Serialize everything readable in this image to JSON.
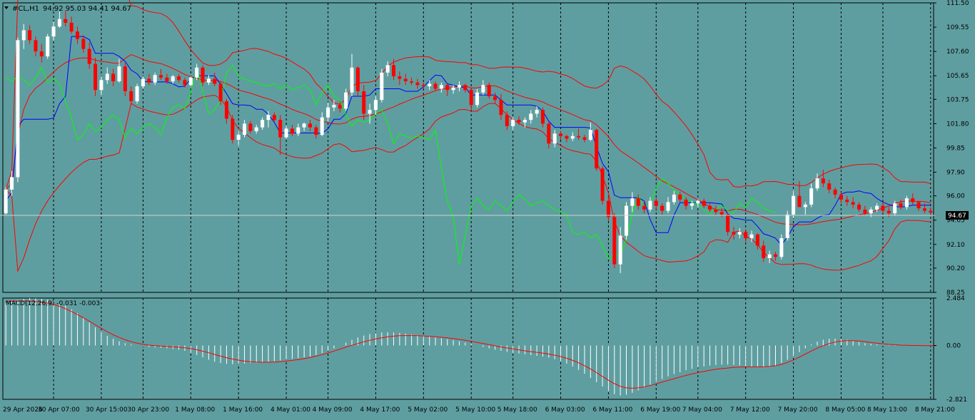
{
  "chart": {
    "symbol_label": "#CL,H1",
    "ohlc": "94.92 95.03 94.41 94.67",
    "current_price": "94.67"
  },
  "macd": {
    "label": "MACD(12,26,9) -0.031 -0.003"
  },
  "price_axis": [
    "111.50",
    "109.55",
    "107.60",
    "105.65",
    "103.75",
    "101.80",
    "99.85",
    "97.90",
    "96.00",
    "94.05",
    "92.10",
    "90.20",
    "88.25"
  ],
  "macd_axis": [
    "2.484",
    "0.00",
    "-2.821"
  ],
  "time_axis": [
    "29 Apr 2026",
    "30 Apr 07:00",
    "30 Apr 15:00",
    "30 Apr 23:00",
    "1 May 08:00",
    "1 May 16:00",
    "4 May 01:00",
    "4 May 09:00",
    "4 May 17:00",
    "5 May 02:00",
    "5 May 10:00",
    "5 May 18:00",
    "6 May 03:00",
    "6 May 11:00",
    "6 May 19:00",
    "7 May 04:00",
    "7 May 12:00",
    "7 May 20:00",
    "8 May 05:00",
    "8 May 13:00",
    "8 May 21:00"
  ],
  "colors": {
    "background": "#5F9EA0",
    "bull": "#FFFFFF",
    "bear": "#FF0000",
    "bands": "#FF0000",
    "tenkan": "#0000FF",
    "chikou": "#00FF00",
    "cloud": "#F4A460",
    "macd_signal": "#FF0000",
    "macd_hist": "#FFFFFF"
  },
  "chart_data": {
    "type": "candlestick",
    "price_range": [
      88.25,
      111.5
    ],
    "macd_range": [
      -2.821,
      2.484
    ],
    "candles": [
      [
        94.6,
        96.7,
        94.5,
        96.5
      ],
      [
        96.5,
        98.0,
        96.0,
        97.5
      ],
      [
        97.5,
        108.7,
        97.1,
        108.5
      ],
      [
        108.5,
        109.8,
        107.8,
        109.3
      ],
      [
        109.3,
        109.7,
        108.2,
        108.5
      ],
      [
        108.5,
        108.8,
        107.2,
        107.6
      ],
      [
        107.6,
        108.2,
        106.7,
        107.2
      ],
      [
        107.2,
        109.0,
        107.0,
        108.8
      ],
      [
        108.8,
        110.0,
        108.5,
        109.6
      ],
      [
        109.6,
        110.8,
        109.5,
        110.2
      ],
      [
        110.2,
        110.9,
        109.6,
        109.9
      ],
      [
        109.9,
        110.4,
        109.0,
        109.2
      ],
      [
        109.2,
        109.6,
        108.2,
        108.6
      ],
      [
        108.6,
        108.9,
        107.5,
        107.8
      ],
      [
        107.8,
        108.3,
        106.2,
        106.6
      ],
      [
        106.6,
        107.1,
        104.0,
        104.5
      ],
      [
        104.5,
        105.6,
        104.1,
        105.3
      ],
      [
        105.3,
        106.3,
        105.0,
        105.8
      ],
      [
        105.8,
        106.2,
        104.8,
        105.2
      ],
      [
        105.2,
        107.0,
        105.1,
        106.4
      ],
      [
        106.4,
        106.7,
        104.0,
        104.4
      ],
      [
        104.4,
        104.8,
        103.3,
        103.6
      ],
      [
        103.6,
        105.0,
        103.4,
        104.8
      ],
      [
        104.8,
        105.6,
        104.6,
        105.4
      ],
      [
        105.4,
        105.8,
        104.9,
        105.1
      ],
      [
        105.1,
        105.9,
        104.9,
        105.7
      ],
      [
        105.7,
        106.2,
        105.3,
        105.5
      ],
      [
        105.5,
        105.8,
        105.0,
        105.2
      ],
      [
        105.2,
        105.7,
        105.0,
        105.6
      ],
      [
        105.6,
        105.8,
        105.1,
        105.3
      ],
      [
        105.3,
        105.5,
        104.7,
        104.9
      ],
      [
        104.9,
        105.6,
        104.8,
        105.5
      ],
      [
        105.5,
        106.6,
        105.3,
        106.3
      ],
      [
        106.3,
        106.5,
        104.8,
        105.1
      ],
      [
        105.1,
        105.7,
        104.9,
        105.4
      ],
      [
        105.4,
        105.9,
        104.8,
        105.0
      ],
      [
        105.0,
        105.1,
        103.3,
        103.6
      ],
      [
        103.6,
        103.8,
        101.8,
        102.2
      ],
      [
        102.2,
        102.5,
        100.2,
        100.5
      ],
      [
        100.5,
        101.2,
        100.0,
        100.9
      ],
      [
        100.9,
        102.1,
        100.7,
        101.8
      ],
      [
        101.8,
        102.0,
        101.0,
        101.2
      ],
      [
        101.2,
        101.7,
        101.0,
        101.5
      ],
      [
        101.5,
        102.3,
        101.3,
        102.1
      ],
      [
        102.1,
        102.8,
        101.5,
        102.5
      ],
      [
        102.5,
        102.7,
        101.9,
        102.1
      ],
      [
        102.1,
        102.5,
        99.3,
        100.7
      ],
      [
        100.7,
        101.6,
        100.6,
        101.4
      ],
      [
        101.4,
        101.7,
        100.8,
        101.0
      ],
      [
        101.0,
        101.8,
        100.8,
        101.5
      ],
      [
        101.5,
        101.9,
        101.2,
        101.8
      ],
      [
        101.8,
        102.1,
        101.2,
        101.5
      ],
      [
        101.5,
        101.7,
        100.6,
        100.9
      ],
      [
        100.9,
        102.7,
        100.8,
        102.3
      ],
      [
        102.3,
        103.5,
        102.0,
        103.1
      ],
      [
        103.1,
        103.7,
        102.8,
        103.3
      ],
      [
        103.3,
        103.6,
        102.7,
        103.0
      ],
      [
        103.0,
        104.6,
        102.8,
        104.3
      ],
      [
        104.3,
        107.4,
        104.0,
        106.3
      ],
      [
        106.3,
        106.4,
        104.0,
        104.4
      ],
      [
        104.4,
        104.9,
        102.1,
        102.6
      ],
      [
        102.6,
        103.4,
        101.8,
        102.9
      ],
      [
        102.9,
        104.0,
        102.5,
        103.7
      ],
      [
        103.7,
        106.2,
        103.5,
        105.9
      ],
      [
        105.9,
        106.8,
        105.6,
        106.5
      ],
      [
        106.5,
        107.0,
        105.3,
        105.6
      ],
      [
        105.6,
        106.0,
        104.9,
        105.4
      ],
      [
        105.4,
        105.8,
        104.9,
        105.2
      ],
      [
        105.2,
        105.5,
        104.9,
        105.1
      ],
      [
        105.1,
        105.4,
        104.6,
        104.9
      ],
      [
        104.9,
        105.1,
        104.6,
        104.8
      ],
      [
        104.8,
        105.3,
        104.5,
        105.0
      ],
      [
        105.0,
        105.2,
        104.4,
        104.6
      ],
      [
        104.6,
        105.1,
        104.3,
        104.9
      ],
      [
        104.9,
        105.0,
        104.0,
        104.5
      ],
      [
        104.5,
        104.9,
        104.2,
        104.7
      ],
      [
        104.7,
        105.2,
        104.4,
        104.9
      ],
      [
        104.9,
        105.0,
        104.3,
        104.5
      ],
      [
        104.5,
        104.7,
        102.9,
        103.3
      ],
      [
        103.3,
        104.6,
        103.1,
        104.3
      ],
      [
        104.3,
        105.3,
        104.1,
        104.9
      ],
      [
        104.9,
        105.1,
        103.8,
        104.0
      ],
      [
        104.0,
        104.3,
        103.4,
        103.7
      ],
      [
        103.7,
        104.2,
        102.1,
        102.5
      ],
      [
        102.5,
        102.8,
        101.3,
        101.6
      ],
      [
        101.6,
        102.3,
        101.3,
        102.1
      ],
      [
        102.1,
        102.4,
        101.7,
        101.9
      ],
      [
        101.9,
        102.3,
        101.5,
        102.1
      ],
      [
        102.1,
        102.9,
        101.8,
        102.6
      ],
      [
        102.6,
        103.2,
        102.3,
        102.9
      ],
      [
        102.9,
        103.1,
        101.5,
        101.8
      ],
      [
        101.8,
        101.9,
        99.8,
        100.2
      ],
      [
        100.2,
        101.3,
        99.9,
        101.0
      ],
      [
        101.0,
        101.2,
        100.5,
        100.8
      ],
      [
        100.8,
        100.9,
        100.3,
        100.6
      ],
      [
        100.6,
        101.1,
        100.4,
        100.8
      ],
      [
        100.8,
        101.4,
        100.5,
        100.7
      ],
      [
        100.7,
        100.9,
        100.3,
        100.5
      ],
      [
        100.5,
        101.9,
        100.4,
        101.3
      ],
      [
        101.3,
        101.4,
        98.0,
        98.2
      ],
      [
        98.2,
        98.4,
        95.3,
        95.6
      ],
      [
        95.6,
        96.0,
        94.0,
        94.3
      ],
      [
        94.3,
        94.6,
        90.2,
        90.5
      ],
      [
        90.5,
        93.5,
        89.8,
        92.8
      ],
      [
        92.8,
        95.5,
        92.5,
        95.2
      ],
      [
        95.2,
        96.3,
        94.7,
        95.8
      ],
      [
        95.8,
        96.1,
        94.9,
        95.2
      ],
      [
        95.2,
        95.6,
        94.6,
        94.9
      ],
      [
        94.9,
        95.9,
        94.7,
        95.6
      ],
      [
        95.6,
        95.8,
        94.9,
        95.2
      ],
      [
        95.2,
        95.4,
        94.5,
        94.8
      ],
      [
        94.8,
        95.9,
        94.6,
        95.5
      ],
      [
        95.5,
        96.4,
        95.3,
        96.1
      ],
      [
        96.1,
        96.3,
        95.5,
        95.7
      ],
      [
        95.7,
        95.9,
        94.9,
        95.2
      ],
      [
        95.2,
        95.6,
        94.9,
        95.4
      ],
      [
        95.4,
        95.7,
        95.1,
        95.6
      ],
      [
        95.6,
        95.8,
        95.0,
        95.2
      ],
      [
        95.2,
        95.4,
        94.7,
        94.9
      ],
      [
        94.9,
        95.2,
        94.4,
        94.7
      ],
      [
        94.7,
        95.0,
        94.3,
        94.5
      ],
      [
        94.5,
        94.6,
        92.8,
        93.1
      ],
      [
        93.1,
        93.5,
        92.5,
        92.9
      ],
      [
        92.9,
        93.4,
        92.6,
        93.1
      ],
      [
        93.1,
        93.3,
        92.3,
        92.6
      ],
      [
        92.6,
        93.2,
        92.3,
        92.9
      ],
      [
        92.9,
        93.0,
        91.7,
        92.0
      ],
      [
        92.0,
        92.4,
        90.7,
        91.0
      ],
      [
        91.0,
        91.6,
        90.6,
        91.3
      ],
      [
        91.3,
        91.5,
        90.8,
        91.1
      ],
      [
        91.1,
        92.9,
        90.9,
        92.6
      ],
      [
        92.6,
        94.8,
        92.4,
        94.5
      ],
      [
        94.5,
        96.4,
        94.2,
        96.0
      ],
      [
        96.0,
        97.2,
        95.8,
        95.1
      ],
      [
        95.1,
        95.5,
        94.5,
        95.3
      ],
      [
        95.3,
        97.0,
        95.1,
        96.6
      ],
      [
        96.6,
        97.8,
        96.4,
        97.4
      ],
      [
        97.4,
        98.1,
        96.7,
        97.0
      ],
      [
        97.0,
        97.3,
        96.2,
        96.5
      ],
      [
        96.5,
        96.7,
        95.8,
        96.1
      ],
      [
        96.1,
        96.3,
        95.4,
        95.7
      ],
      [
        95.7,
        96.0,
        95.2,
        95.5
      ],
      [
        95.5,
        95.9,
        95.0,
        95.3
      ],
      [
        95.3,
        95.5,
        94.7,
        94.9
      ],
      [
        94.9,
        95.2,
        94.4,
        94.6
      ],
      [
        94.6,
        95.1,
        94.3,
        94.9
      ],
      [
        94.9,
        95.4,
        94.7,
        95.2
      ],
      [
        95.2,
        95.5,
        94.6,
        94.8
      ],
      [
        94.8,
        95.1,
        94.3,
        94.6
      ],
      [
        94.6,
        95.6,
        94.4,
        95.4
      ],
      [
        95.4,
        95.7,
        94.9,
        95.1
      ],
      [
        95.1,
        96.0,
        94.9,
        95.8
      ],
      [
        95.8,
        96.2,
        95.3,
        95.5
      ],
      [
        95.5,
        95.6,
        94.8,
        95.0
      ],
      [
        95.0,
        95.4,
        94.6,
        94.8
      ],
      [
        94.8,
        95.1,
        94.4,
        94.67
      ]
    ],
    "macd_histogram": [
      2.2,
      2.3,
      2.4,
      2.45,
      2.48,
      2.47,
      2.45,
      2.4,
      2.35,
      2.25,
      2.1,
      1.9,
      1.7,
      1.45,
      1.2,
      0.95,
      0.7,
      0.5,
      0.35,
      0.22,
      0.12,
      0.05,
      0.0,
      -0.05,
      -0.08,
      -0.1,
      -0.12,
      -0.15,
      -0.18,
      -0.22,
      -0.28,
      -0.38,
      -0.5,
      -0.62,
      -0.75,
      -0.85,
      -0.92,
      -0.96,
      -0.98,
      -0.97,
      -0.95,
      -0.92,
      -0.9,
      -0.88,
      -0.85,
      -0.82,
      -0.78,
      -0.74,
      -0.7,
      -0.66,
      -0.62,
      -0.58,
      -0.5,
      -0.4,
      -0.28,
      -0.15,
      0.0,
      0.15,
      0.3,
      0.42,
      0.52,
      0.6,
      0.65,
      0.68,
      0.69,
      0.68,
      0.65,
      0.62,
      0.58,
      0.54,
      0.5,
      0.46,
      0.42,
      0.38,
      0.33,
      0.28,
      0.22,
      0.15,
      0.08,
      0.0,
      -0.08,
      -0.15,
      -0.22,
      -0.28,
      -0.33,
      -0.38,
      -0.42,
      -0.46,
      -0.5,
      -0.54,
      -0.58,
      -0.64,
      -0.72,
      -0.82,
      -0.95,
      -1.1,
      -1.28,
      -1.48,
      -1.7,
      -1.92,
      -2.15,
      -2.38,
      -2.55,
      -2.62,
      -2.58,
      -2.48,
      -2.35,
      -2.2,
      -2.05,
      -1.9,
      -1.76,
      -1.62,
      -1.5,
      -1.4,
      -1.3,
      -1.22,
      -1.15,
      -1.1,
      -1.05,
      -1.02,
      -1.0,
      -1.0,
      -1.02,
      -1.05,
      -1.08,
      -1.12,
      -1.14,
      -1.15,
      -1.12,
      -1.05,
      -0.92,
      -0.75,
      -0.55,
      -0.35,
      -0.15,
      0.05,
      0.2,
      0.3,
      0.35,
      0.36,
      0.34,
      0.3,
      0.24,
      0.18,
      0.12,
      0.08,
      0.05,
      0.03,
      0.02,
      0.02,
      0.01,
      0.0,
      0.0,
      -0.01,
      -0.02,
      -0.03
    ],
    "macd_signal": [
      2.3,
      2.32,
      2.33,
      2.33,
      2.32,
      2.3,
      2.27,
      2.22,
      2.15,
      2.05,
      1.92,
      1.78,
      1.62,
      1.45,
      1.27,
      1.08,
      0.9,
      0.72,
      0.56,
      0.42,
      0.3,
      0.2,
      0.12,
      0.06,
      0.02,
      -0.01,
      -0.03,
      -0.05,
      -0.07,
      -0.09,
      -0.12,
      -0.16,
      -0.22,
      -0.3,
      -0.38,
      -0.47,
      -0.56,
      -0.64,
      -0.71,
      -0.77,
      -0.82,
      -0.85,
      -0.87,
      -0.88,
      -0.88,
      -0.87,
      -0.85,
      -0.82,
      -0.78,
      -0.74,
      -0.69,
      -0.63,
      -0.56,
      -0.48,
      -0.39,
      -0.29,
      -0.19,
      -0.09,
      0.01,
      0.1,
      0.19,
      0.27,
      0.34,
      0.4,
      0.45,
      0.49,
      0.51,
      0.52,
      0.52,
      0.51,
      0.5,
      0.48,
      0.46,
      0.43,
      0.4,
      0.36,
      0.32,
      0.27,
      0.22,
      0.16,
      0.1,
      0.04,
      -0.02,
      -0.08,
      -0.13,
      -0.18,
      -0.23,
      -0.28,
      -0.32,
      -0.36,
      -0.4,
      -0.45,
      -0.51,
      -0.58,
      -0.67,
      -0.78,
      -0.91,
      -1.06,
      -1.23,
      -1.42,
      -1.62,
      -1.82,
      -2.0,
      -2.14,
      -2.22,
      -2.24,
      -2.22,
      -2.17,
      -2.1,
      -2.01,
      -1.92,
      -1.83,
      -1.74,
      -1.65,
      -1.57,
      -1.49,
      -1.42,
      -1.36,
      -1.3,
      -1.25,
      -1.21,
      -1.18,
      -1.15,
      -1.13,
      -1.12,
      -1.12,
      -1.12,
      -1.12,
      -1.1,
      -1.06,
      -0.99,
      -0.89,
      -0.76,
      -0.61,
      -0.45,
      -0.29,
      -0.14,
      -0.01,
      0.1,
      0.18,
      0.23,
      0.25,
      0.25,
      0.23,
      0.2,
      0.16,
      0.12,
      0.09,
      0.06,
      0.04,
      0.02,
      0.01,
      0.0,
      0.0,
      -0.01,
      -0.01,
      -0.003
    ]
  }
}
